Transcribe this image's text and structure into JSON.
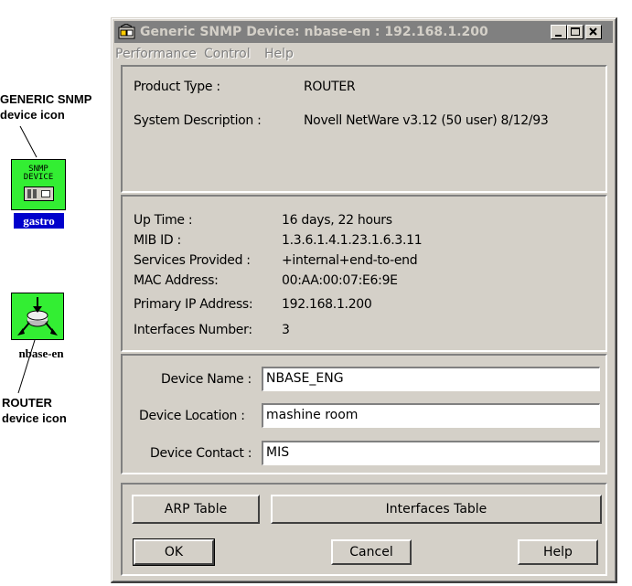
{
  "annotations": {
    "snmp_label_line1": "GENERIC SNMP",
    "snmp_label_line2": "device icon",
    "snmp_icon_text_line1": "SNMP",
    "snmp_icon_text_line2": "DEVICE",
    "snmp_device_name": "gastro",
    "router_label_line1": "ROUTER",
    "router_label_line2": "device icon",
    "router_device_name": "nbase-en"
  },
  "window": {
    "title": "Generic SNMP Device: nbase-en : 192.168.1.200",
    "menu": [
      "Performance",
      "Control",
      "Help"
    ]
  },
  "product": {
    "product_type_label": "Product Type :",
    "product_type_value": "ROUTER",
    "system_description_label": "System Description :",
    "system_description_value": "Novell NetWare v3.12 (50 user)  8/12/93"
  },
  "system_info": {
    "rows": [
      {
        "label": "Up Time :",
        "value": "16 days, 22 hours"
      },
      {
        "label": "MIB ID :",
        "value": "1.3.6.1.4.1.23.1.6.3.11"
      },
      {
        "label": "Services Provided :",
        "value": "+internal+end-to-end"
      },
      {
        "label": "MAC Address:",
        "value": "00:AA:00:07:E6:9E"
      },
      {
        "label": "Primary IP Address:",
        "value": "192.168.1.200"
      },
      {
        "label": "Interfaces Number:",
        "value": "3"
      }
    ]
  },
  "device": {
    "name_label": "Device Name :",
    "name_value": "NBASE_ENG",
    "location_label": "Device Location :",
    "location_value": "mashine room",
    "contact_label": "Device Contact :",
    "contact_value": "MIS"
  },
  "buttons": {
    "arp_table": "ARP Table",
    "interfaces_table": "Interfaces Table",
    "ok": "OK",
    "cancel": "Cancel",
    "help": "Help"
  },
  "colors": {
    "face": "#d4d0c8",
    "titlebar_inactive": "#808080",
    "icon_green": "#33ee33",
    "selection_blue": "#0000cc"
  }
}
